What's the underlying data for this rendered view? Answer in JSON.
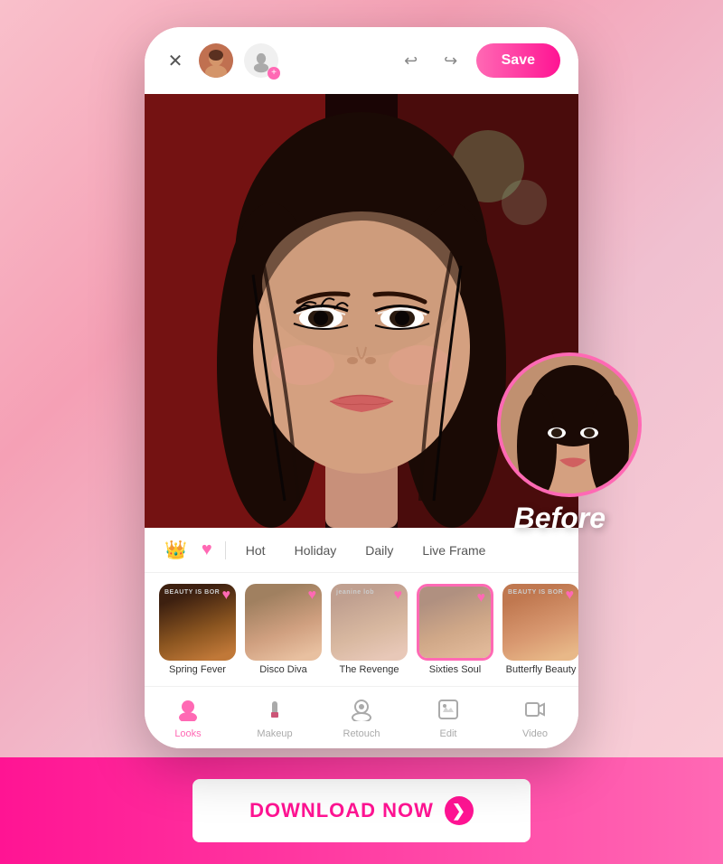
{
  "header": {
    "close_label": "✕",
    "undo_label": "↩",
    "redo_label": "↪",
    "save_label": "Save"
  },
  "photo": {
    "alt": "Woman with makeup"
  },
  "filter_tabs": {
    "crown": "👑",
    "heart": "♥",
    "items": [
      {
        "label": "Hot",
        "active": false
      },
      {
        "label": "Holiday",
        "active": false
      },
      {
        "label": "Daily",
        "active": false
      },
      {
        "label": "Live Frame",
        "active": false
      }
    ]
  },
  "looks": [
    {
      "label": "Spring Fever",
      "selected": false,
      "top_text": "BEAUTY IS BOR"
    },
    {
      "label": "Disco Diva",
      "selected": false,
      "top_text": ""
    },
    {
      "label": "The Revenge",
      "selected": false,
      "top_text": "jeanine lob"
    },
    {
      "label": "Sixties Soul",
      "selected": true,
      "top_text": ""
    },
    {
      "label": "Butterfly Beauty",
      "selected": false,
      "top_text": "BEAUTY IS BOR"
    }
  ],
  "before_label": "Before",
  "bottom_nav": [
    {
      "label": "Looks",
      "icon": "👤",
      "active": true
    },
    {
      "label": "Makeup",
      "icon": "💄",
      "active": false
    },
    {
      "label": "Retouch",
      "icon": "✨",
      "active": false
    },
    {
      "label": "Edit",
      "icon": "🖼",
      "active": false
    },
    {
      "label": "Video",
      "icon": "▶",
      "active": false
    }
  ],
  "download": {
    "label": "DOWNLOAD NOW",
    "arrow": "❯"
  }
}
